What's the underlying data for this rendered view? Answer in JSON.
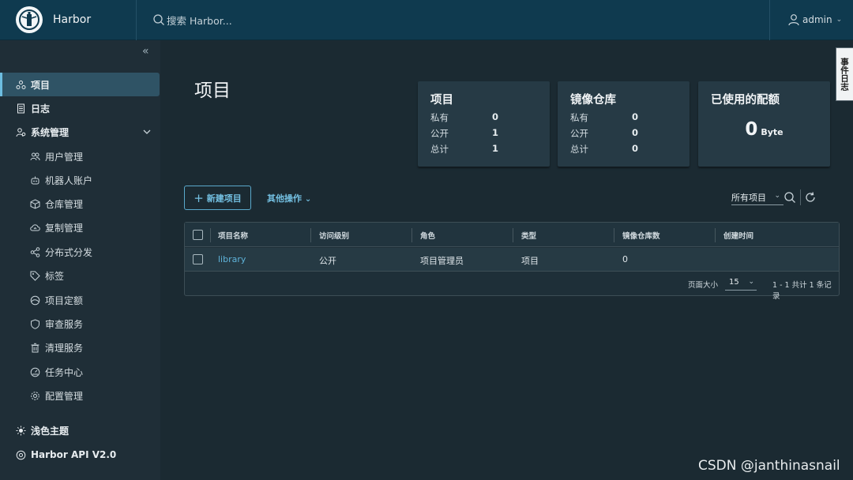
{
  "header": {
    "brand": "Harbor",
    "search_placeholder": "搜索 Harbor...",
    "user": "admin"
  },
  "sidebar": {
    "items": [
      {
        "label": "项目",
        "icon": "projects-icon",
        "active": true
      },
      {
        "label": "日志",
        "icon": "logs-icon"
      },
      {
        "label": "系统管理",
        "icon": "admin-icon"
      }
    ],
    "sub_items": [
      {
        "label": "用户管理",
        "icon": "users-icon"
      },
      {
        "label": "机器人账户",
        "icon": "robot-icon"
      },
      {
        "label": "仓库管理",
        "icon": "registry-icon"
      },
      {
        "label": "复制管理",
        "icon": "replication-icon"
      },
      {
        "label": "分布式分发",
        "icon": "distribution-icon"
      },
      {
        "label": "标签",
        "icon": "tag-icon"
      },
      {
        "label": "项目定额",
        "icon": "quota-icon"
      },
      {
        "label": "审查服务",
        "icon": "shield-icon"
      },
      {
        "label": "清理服务",
        "icon": "trash-icon"
      },
      {
        "label": "任务中心",
        "icon": "dashboard-icon"
      },
      {
        "label": "配置管理",
        "icon": "gear-icon"
      }
    ],
    "bottom": [
      {
        "label": "浅色主题",
        "icon": "sun-icon"
      },
      {
        "label": "Harbor API V2.0",
        "icon": "api-icon"
      }
    ]
  },
  "main": {
    "title": "项目",
    "cards": {
      "projects": {
        "title": "项目",
        "rows": [
          {
            "label": "私有",
            "value": "0"
          },
          {
            "label": "公开",
            "value": "1"
          },
          {
            "label": "总计",
            "value": "1"
          }
        ]
      },
      "repos": {
        "title": "镜像仓库",
        "rows": [
          {
            "label": "私有",
            "value": "0"
          },
          {
            "label": "公开",
            "value": "0"
          },
          {
            "label": "总计",
            "value": "0"
          }
        ]
      },
      "quota": {
        "title": "已使用的配额",
        "value": "0",
        "unit": "Byte"
      }
    },
    "toolbar": {
      "new_project": "新建项目",
      "other_actions": "其他操作",
      "filter": "所有项目"
    },
    "table": {
      "columns": [
        "项目名称",
        "访问级别",
        "角色",
        "类型",
        "镜像仓库数",
        "创建时间"
      ],
      "rows": [
        {
          "name": "library",
          "access": "公开",
          "role": "项目管理员",
          "type": "项目",
          "repo_count": "0",
          "created": ""
        }
      ],
      "footer": {
        "page_size_label": "页面大小",
        "page_size": "15",
        "summary": "1 - 1 共计 1 条记录"
      }
    },
    "event_log": "事件日志"
  },
  "watermark": "CSDN @janthinasnail",
  "colors": {
    "header": "#0f3a4f",
    "sidebar": "#1f2e37",
    "accent": "#74c0e2",
    "active": "#2f5365"
  }
}
